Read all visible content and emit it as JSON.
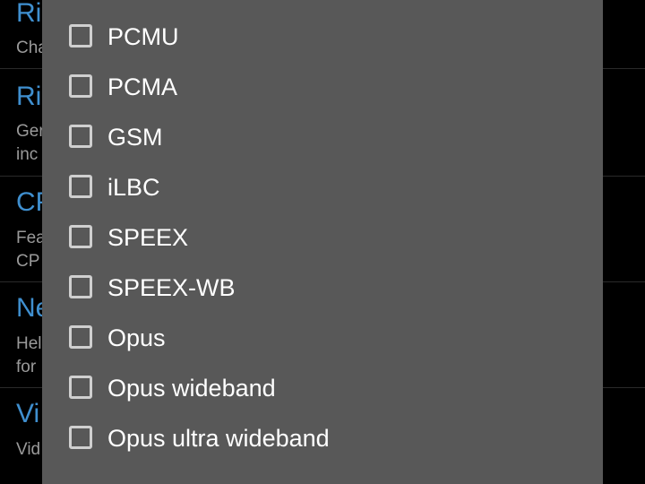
{
  "background_list": [
    {
      "title": "Ri",
      "summary": [
        "Cha"
      ]
    },
    {
      "title": "Ri",
      "summary": [
        "Ger",
        "inc"
      ]
    },
    {
      "title": "CP",
      "summary": [
        "Fea",
        "CP"
      ]
    },
    {
      "title": "Ne",
      "summary": [
        "Hel",
        "for"
      ]
    },
    {
      "title": "Vi",
      "summary": [
        "Vid"
      ]
    }
  ],
  "dialog": {
    "options": [
      {
        "label": "PCMU",
        "checked": false
      },
      {
        "label": "PCMA",
        "checked": false
      },
      {
        "label": "GSM",
        "checked": false
      },
      {
        "label": "iLBC",
        "checked": false
      },
      {
        "label": "SPEEX",
        "checked": false
      },
      {
        "label": "SPEEX-WB",
        "checked": false
      },
      {
        "label": "Opus",
        "checked": false
      },
      {
        "label": "Opus wideband",
        "checked": false
      },
      {
        "label": "Opus ultra wideband",
        "checked": false
      }
    ]
  },
  "colors": {
    "background": "#000000",
    "dialog": "#585858",
    "accent_title": "#3f8fcf",
    "summary_text": "#9a9a9a",
    "option_text": "#ffffff",
    "checkbox_border": "#cfcfcf"
  }
}
